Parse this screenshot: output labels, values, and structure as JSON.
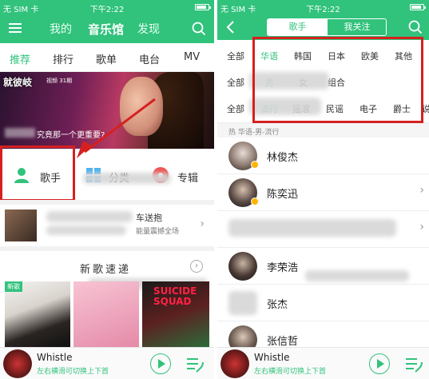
{
  "status": {
    "carrier": "无 SIM 卡",
    "time": "下午2:22"
  },
  "left": {
    "top_tabs": [
      "我的",
      "音乐馆",
      "发现"
    ],
    "subnav": [
      "推荐",
      "排行",
      "歌单",
      "电台",
      "MV"
    ],
    "banner": {
      "logo": "就彼岐",
      "logo_sub": "视频 31期",
      "caption": "究竟那一个更重要?"
    },
    "categories": [
      "歌手",
      "分类",
      "专辑"
    ],
    "row": {
      "title": "车送抱",
      "subtitle": "能量震撼全场"
    },
    "new_songs": {
      "title": "新歌速递",
      "badge": "新歌",
      "album3_text": "SUICIDE SQUAD",
      "more": "›"
    }
  },
  "right": {
    "tabs": [
      "歌手",
      "我关注"
    ],
    "filter_row1": [
      "全部",
      "华语",
      "韩国",
      "日本",
      "欧美",
      "其他"
    ],
    "filter_row2": [
      "全部",
      "男",
      "女",
      "组合"
    ],
    "filter_row3": [
      "全部",
      "流行",
      "摇滚",
      "民谣",
      "电子",
      "爵士",
      "说"
    ],
    "section_label": "热  华语-男-流行",
    "singers": [
      "林俊杰",
      "陈奕迅",
      "李荣浩",
      "张杰",
      "张信哲"
    ]
  },
  "player": {
    "song": "Whistle",
    "hint": "左右横滑可切换上下首"
  },
  "colors": {
    "accent": "#31c27c",
    "highlight": "#d62020"
  }
}
